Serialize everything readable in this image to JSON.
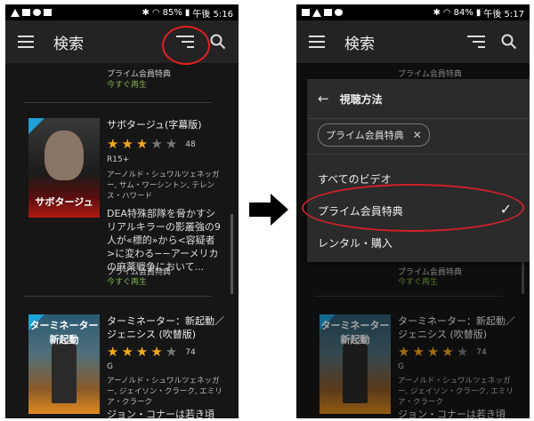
{
  "status_left": {
    "battery": "85%",
    "time": "午後 5:16"
  },
  "status_right": {
    "battery": "84%",
    "time": "午後 5:17"
  },
  "appbar": {
    "title": "検索"
  },
  "list_top": {
    "prime": "プライム会員特典",
    "watch": "今すぐ再生"
  },
  "items": [
    {
      "title": "サボタージュ(字幕版)",
      "poster_caption": "サボタージュ",
      "stars": 3,
      "count": "48",
      "rating": "R15+",
      "cast": "アーノルド・シュワルツェネッガー, サム・ワーシントン, テレンス・ハワード",
      "desc": "DEA特殊部隊を脅かすシリアルキラーの影叢強の9人が«標的»から<容疑者>に変わる−−アーメリカの麻薬戦争において...",
      "prime": "プライム会員特典",
      "watch": "今すぐ再生"
    },
    {
      "title": "ターミネーター：新起動／ジェニシス (吹替版)",
      "poster_caption": "ターミネーター 新起動",
      "stars": 4,
      "count": "74",
      "rating": "G",
      "cast": "アーノルド・シュワルツェネッガー, ジェイソン・クラーク, エミリア・クラーク",
      "desc": "ジョン・コナーは若き頃"
    }
  ],
  "filter_panel": {
    "title": "視聴方法",
    "chip": "プライム会員特典",
    "options": [
      "すべてのビデオ",
      "プライム会員特典",
      "レンタル・購入"
    ],
    "selected_index": 1
  },
  "colors": {
    "star": "#f3a818",
    "watch_green": "#7fb24a",
    "highlight_red": "#e02020"
  }
}
